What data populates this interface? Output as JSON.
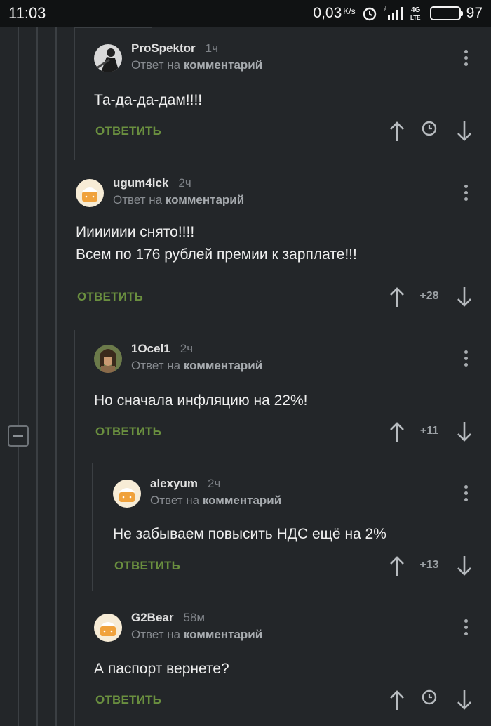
{
  "status_bar": {
    "time": "11:03",
    "speed": "0,03",
    "speed_unit": "K/s",
    "network": "4G LTE",
    "battery": "97"
  },
  "reply_prefix": "Ответ на",
  "reply_target": "комментарий",
  "answer_label": "ОТВЕТИТЬ",
  "comments": [
    {
      "author": "ProSpektor",
      "time": "1ч",
      "lines": [
        "Та-да-да-дам!!!!"
      ],
      "rating": null,
      "avatar": "photo"
    },
    {
      "author": "ugum4ick",
      "time": "2ч",
      "lines": [
        "Иииииии снято!!!!",
        "Всем по 176 рублей премии к зарплате!!!"
      ],
      "rating": "+28",
      "avatar": "default-cake"
    },
    {
      "author": "1Ocel1",
      "time": "2ч",
      "lines": [
        "Но сначала инфляцию на 22%!"
      ],
      "rating": "+11",
      "avatar": "photo"
    },
    {
      "author": "alexyum",
      "time": "2ч",
      "lines": [
        "Не забываем повысить НДС ещё на 2%"
      ],
      "rating": "+13",
      "avatar": "default-cake"
    },
    {
      "author": "G2Bear",
      "time": "58м",
      "lines": [
        "А паспорт вернете?"
      ],
      "rating": null,
      "avatar": "default-cake"
    }
  ],
  "colors": {
    "background": "#232629",
    "answer": "#6a8f3f",
    "thread_line": "#3b3f43"
  }
}
